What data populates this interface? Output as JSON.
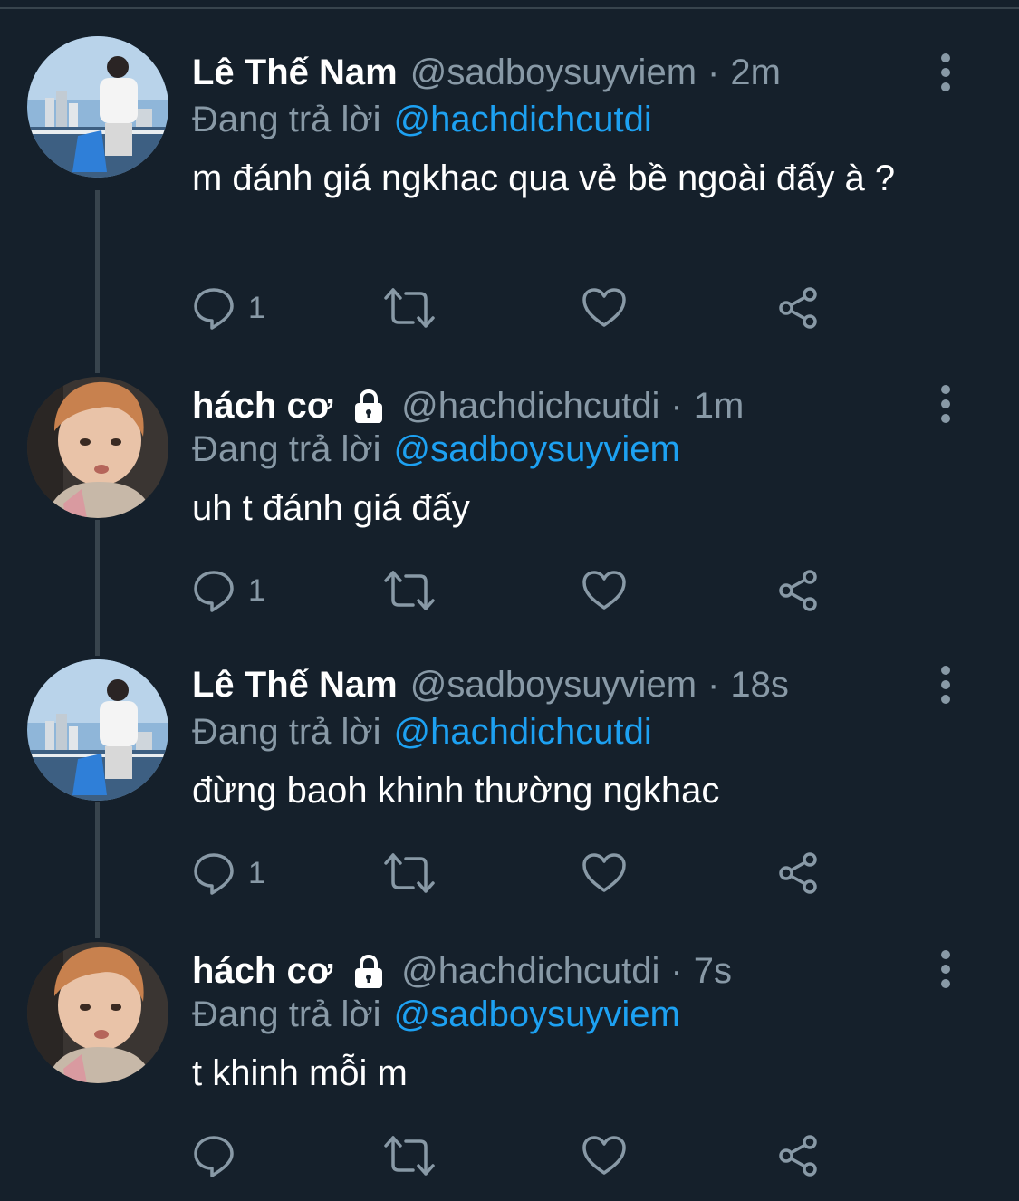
{
  "tweets": [
    {
      "display_name": "Lê Thế Nam",
      "handle": "@sadboysuyviem",
      "separator": "·",
      "time": "2m",
      "reply_prefix": "Đang trả lời",
      "reply_to": "@hachdichcutdi",
      "text": "m đánh giá ngkhac qua vẻ bề ngoài đấy à ?",
      "reply_count": "1",
      "protected": false,
      "avatar_icon": "avatar-photo-man-city-skyline"
    },
    {
      "display_name": "hách cơ",
      "handle": "@hachdichcutdi",
      "separator": "·",
      "time": "1m",
      "reply_prefix": "Đang trả lời",
      "reply_to": "@sadboysuyviem",
      "text": "uh t đánh giá đấy",
      "reply_count": "1",
      "protected": true,
      "avatar_icon": "avatar-photo-selfie"
    },
    {
      "display_name": "Lê Thế Nam",
      "handle": "@sadboysuyviem",
      "separator": "·",
      "time": "18s",
      "reply_prefix": "Đang trả lời",
      "reply_to": "@hachdichcutdi",
      "text": "đừng baoh khinh thường ngkhac",
      "reply_count": "1",
      "protected": false,
      "avatar_icon": "avatar-photo-man-city-skyline"
    },
    {
      "display_name": "hách cơ",
      "handle": "@hachdichcutdi",
      "separator": "·",
      "time": "7s",
      "reply_prefix": "Đang trả lời",
      "reply_to": "@sadboysuyviem",
      "text": "t khinh mỗi m",
      "reply_count": "",
      "protected": true,
      "avatar_icon": "avatar-photo-selfie"
    }
  ],
  "icons": {
    "reply": "reply-icon",
    "retweet": "retweet-icon",
    "like": "heart-icon",
    "share": "share-icon",
    "more": "more-vertical-icon",
    "protected": "lock-icon"
  },
  "colors": {
    "background": "#15202b",
    "primary_text": "#ffffff",
    "secondary_text": "#8899a6",
    "accent": "#1da1f2",
    "divider": "#38444d"
  }
}
